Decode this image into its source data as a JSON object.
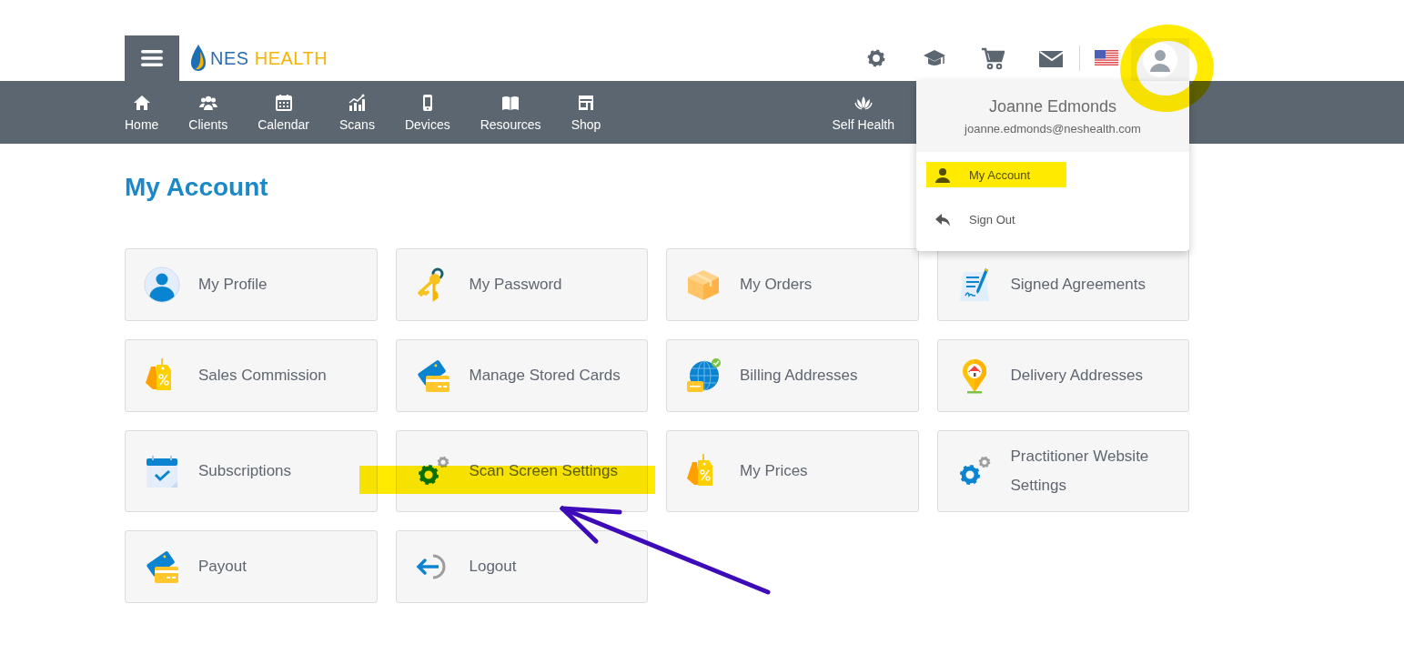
{
  "header": {
    "logo": {
      "brand": "NES",
      "suffix": "HEALTH"
    },
    "toolbar": [
      {
        "kind": "settings"
      },
      {
        "kind": "courses"
      },
      {
        "kind": "cart"
      },
      {
        "kind": "mail"
      }
    ],
    "avatar": {
      "circled": true
    }
  },
  "nav": {
    "items": [
      {
        "label": "Home"
      },
      {
        "label": "Clients"
      },
      {
        "label": "Calendar"
      },
      {
        "label": "Scans"
      },
      {
        "label": "Devices"
      },
      {
        "label": "Resources"
      },
      {
        "label": "Shop"
      }
    ],
    "right_items": [
      {
        "label": "Self Health"
      }
    ]
  },
  "user_menu": {
    "name": "Joanne Edmonds",
    "email": "joanne.edmonds@neshealth.com",
    "items": [
      {
        "label": "My Account",
        "highlighted": true
      },
      {
        "label": "Sign Out",
        "highlighted": false
      }
    ]
  },
  "page": {
    "title": "My Account"
  },
  "tiles": [
    {
      "label": "My Profile",
      "highlighted": false,
      "arrow": false
    },
    {
      "label": "My Password",
      "highlighted": false,
      "arrow": false
    },
    {
      "label": "My Orders",
      "highlighted": false,
      "arrow": false
    },
    {
      "label": "Signed Agreements",
      "highlighted": false,
      "arrow": false
    },
    {
      "label": "Sales Commission",
      "highlighted": false,
      "arrow": false
    },
    {
      "label": "Manage Stored Cards",
      "highlighted": false,
      "arrow": false
    },
    {
      "label": "Billing Addresses",
      "highlighted": false,
      "arrow": false
    },
    {
      "label": "Delivery Addresses",
      "highlighted": false,
      "arrow": false
    },
    {
      "label": "Subscriptions",
      "highlighted": false,
      "arrow": false
    },
    {
      "label": "Scan Screen Settings",
      "highlighted": true,
      "arrow": true
    },
    {
      "label": "My Prices",
      "highlighted": false,
      "arrow": false
    },
    {
      "label": "Practitioner Website Settings",
      "highlighted": false,
      "arrow": false
    },
    {
      "label": "Payout",
      "highlighted": false,
      "arrow": false
    },
    {
      "label": "Logout",
      "highlighted": false,
      "arrow": false
    }
  ]
}
